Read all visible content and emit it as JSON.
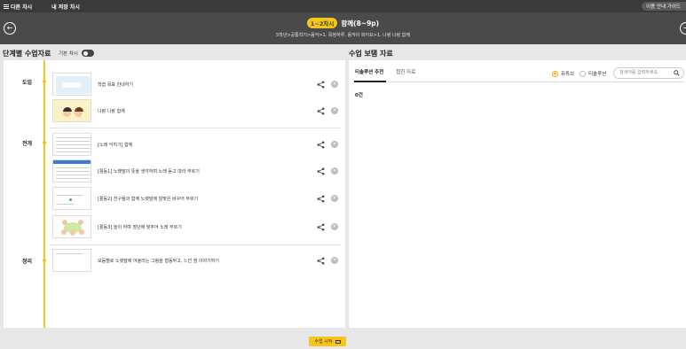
{
  "topbar": {
    "other_lessons": "다른 차시",
    "saved_lessons": "내 저장 차시",
    "guide": "이용 안내 가이드"
  },
  "header": {
    "period_badge": "1~2차시",
    "title": "함께(8~9p)",
    "breadcrumb": "5학년>공통학기>음악>1. 목청하루, 음악이 피어요>1. 나랑 나랑 함께"
  },
  "left": {
    "title": "단계별 수업자료",
    "toggle_label": "기본 차시",
    "stages": [
      {
        "label": "도입"
      },
      {
        "label": "전개"
      },
      {
        "label": "정리"
      }
    ],
    "items": [
      {
        "title": "학습 목표 안내하기",
        "thumb": "blue-slide"
      },
      {
        "title": "나랑 나랑 함께",
        "thumb": "kids-illustration"
      },
      {
        "title": "[노래 익히기] 함께",
        "thumb": "sheet-music"
      },
      {
        "title": "[활동1] 노랫말의 뜻을 생각하며 노래 듣고 따라 부르기",
        "thumb": "sheet-music-blue"
      },
      {
        "title": "[활동2] 친구들과 함께 노랫말에 알맞은 바꾸어 부르기",
        "thumb": "green-slide"
      },
      {
        "title": "[활동3] 놀이 하며 장단에 맞추어 노래 부르기",
        "thumb": "circle-kids"
      },
      {
        "title": "모둠별로 노랫말에 어울리는 그림을 협동하고, 느낀 점 이야기하기",
        "thumb": "doc"
      }
    ]
  },
  "right": {
    "title": "수업 보탬 자료",
    "tabs": [
      "티솔루션 추천",
      "협한 자료"
    ],
    "radio": [
      "유튜브",
      "티솔루션"
    ],
    "search_placeholder": "검색어를 입력하세요.",
    "count": "0건"
  },
  "bottom": {
    "start_label": "수업 시작"
  },
  "colors": {
    "accent": "#f5c518",
    "header_bg": "#4a4a4a",
    "topbar_bg": "#3a3a3a"
  }
}
